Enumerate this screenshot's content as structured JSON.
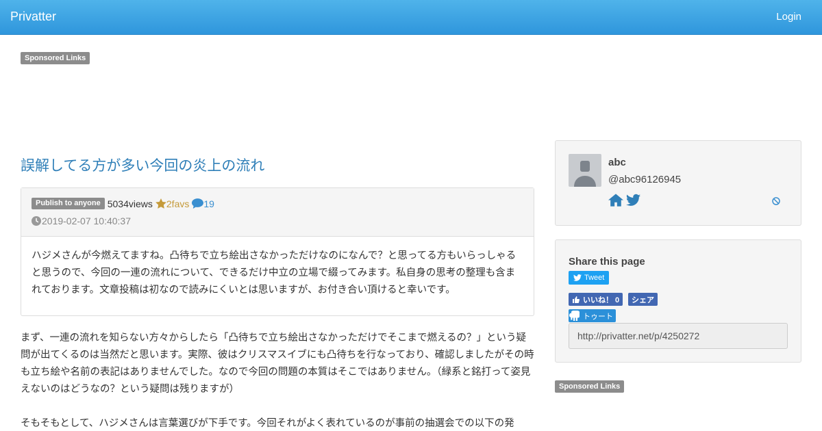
{
  "navbar": {
    "brand": "Privatter",
    "login": "Login"
  },
  "sponsored_label": "Sponsored Links",
  "post": {
    "title": "誤解してる方が多い今回の炎上の流れ",
    "visibility": "Publish to anyone",
    "views": "5034views",
    "favs": "2favs",
    "comments": "19",
    "date": "2019-02-07 10:40:37",
    "intro": "ハジメさんが今燃えてますね。凸待ちで立ち絵出さなかっただけなのになんで？と思ってる方もいらっしゃると思うので、今回の一連の流れについて、できるだけ中立の立場で綴ってみます。私自身の思考の整理も含まれております。文章投稿は初なので読みにくいとは思いますが、お付き合い頂けると幸いです。",
    "paragraphs": [
      "まず、一連の流れを知らない方々からしたら「凸待ちで立ち絵出さなかっただけでそこまで燃えるの？」という疑問が出てくるのは当然だと思います。実際、彼はクリスマスイブにも凸待ちを行なっており、確認しましたがその時も立ち絵や名前の表記はありませんでした。なので今回の問題の本質はそこではありません。（緑系と銘打って姿見えないのはどうなの？という疑問は残りますが）",
      "そもそもとして、ハジメさんは言葉選びが下手です。今回それがよく表れているのが事前の抽選会での以下の発"
    ]
  },
  "profile": {
    "name": "abc",
    "handle": "@abc96126945"
  },
  "share": {
    "title": "Share this page",
    "tweet": "Tweet",
    "like": "いいね！ 0",
    "share": "シェア",
    "toot": "トゥート",
    "url": "http://privatter.net/p/4250272"
  },
  "colors": {
    "navbar": "#2f96dc",
    "link": "#2f7fb8",
    "favs": "#c59a3a",
    "comments": "#3a8fd0",
    "facebook": "#4267b2",
    "twitter": "#1da1f2"
  }
}
